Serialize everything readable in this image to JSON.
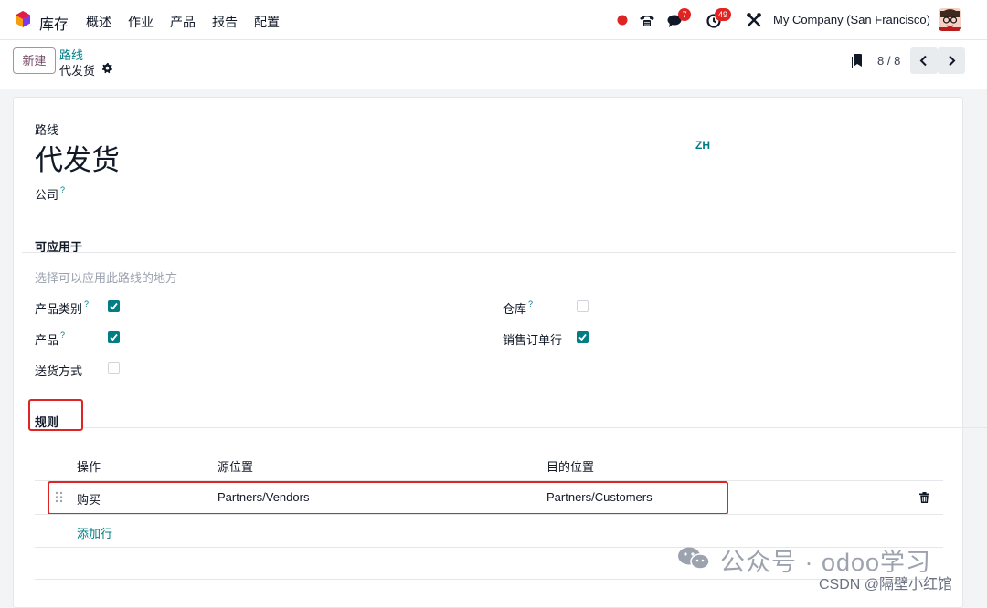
{
  "topnav": {
    "app_name": "库存",
    "menus": [
      "概述",
      "作业",
      "产品",
      "报告",
      "配置"
    ],
    "chat_badge": "7",
    "activity_badge": "49",
    "company": "My Company (San Francisco)"
  },
  "controlpanel": {
    "new_label": "新建",
    "breadcrumb_parent": "路线",
    "breadcrumb_current": "代发货",
    "pager_value": "8 / 8"
  },
  "form": {
    "name_label": "路线",
    "name_value": "代发货",
    "lang_tag": "ZH",
    "company_label": "公司",
    "qmark": "?",
    "applicable_title": "可应用于",
    "applicable_hint": "选择可以应用此路线的地方",
    "fields": [
      {
        "label": "产品类别",
        "checked": true
      },
      {
        "label": "产品",
        "checked": true
      },
      {
        "label": "送货方式",
        "checked": false
      },
      {
        "label": "仓库",
        "checked": false
      },
      {
        "label": "销售订单行",
        "checked": true
      }
    ],
    "rules_title": "规则",
    "rules_headers": [
      "操作",
      "源位置",
      "目的位置"
    ],
    "rules_rows": [
      {
        "action": "购买",
        "source": "Partners/Vendors",
        "dest": "Partners/Customers"
      }
    ],
    "add_line": "添加行"
  },
  "watermark": {
    "line1": "公众号 · odoo学习",
    "line2": "CSDN @隔壁小红馆"
  },
  "colors": {
    "brand": "#714b67",
    "accent": "#017e84",
    "highlight": "#e02424"
  }
}
